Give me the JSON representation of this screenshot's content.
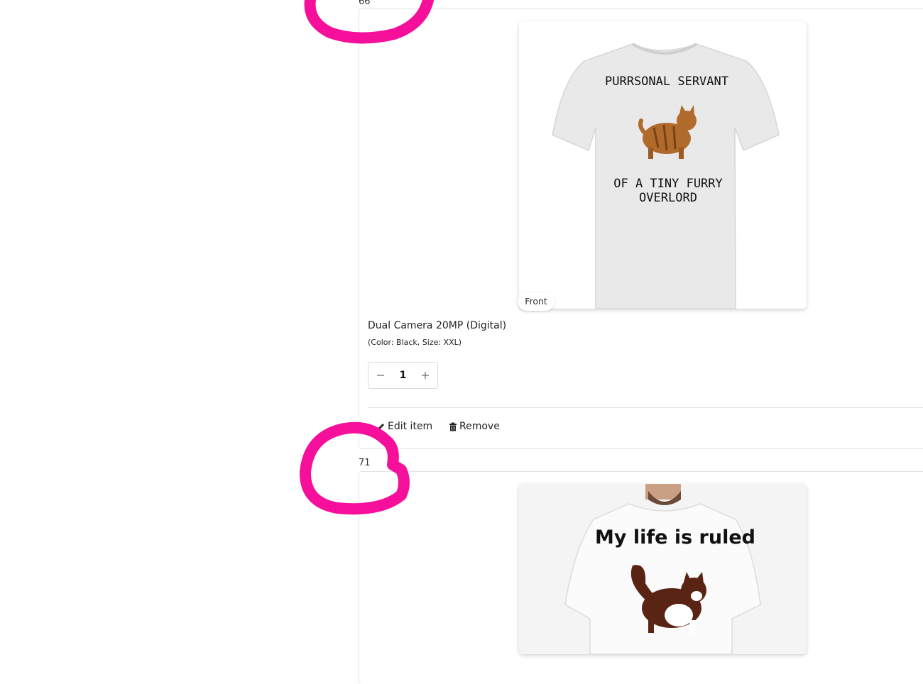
{
  "items": [
    {
      "number": "66",
      "image_label": "Front",
      "design_lines": [
        "PURRSONAL SERVANT",
        "OF A TINY FURRY",
        "OVERLORD"
      ],
      "product_name": "Dual Camera 20MP (Digital)",
      "options": "(Color: Black, Size: XXL)",
      "quantity": "1",
      "edit_label": "Edit item",
      "remove_label": "Remove"
    },
    {
      "number": "71",
      "design_lines": [
        "My life is ruled"
      ]
    }
  ],
  "colors": {
    "annotation": "#f50f9b",
    "border": "#e4e4e4"
  }
}
